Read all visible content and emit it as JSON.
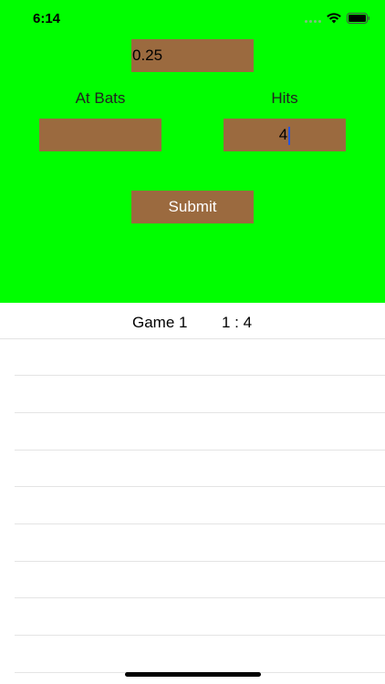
{
  "status_bar": {
    "time": "6:14",
    "signal": "signal-icon",
    "wifi": "wifi-icon",
    "battery": "battery-icon"
  },
  "form": {
    "average_value": "0.25",
    "at_bats_label": "At Bats",
    "hits_label": "Hits",
    "at_bats_value": "",
    "hits_value": "4",
    "submit_label": "Submit"
  },
  "games": [
    {
      "game": "Game 1",
      "score": "1 : 4"
    }
  ],
  "colors": {
    "panel": "#00fe00",
    "field": "#9b6a3f",
    "caret": "#2b55d8"
  }
}
